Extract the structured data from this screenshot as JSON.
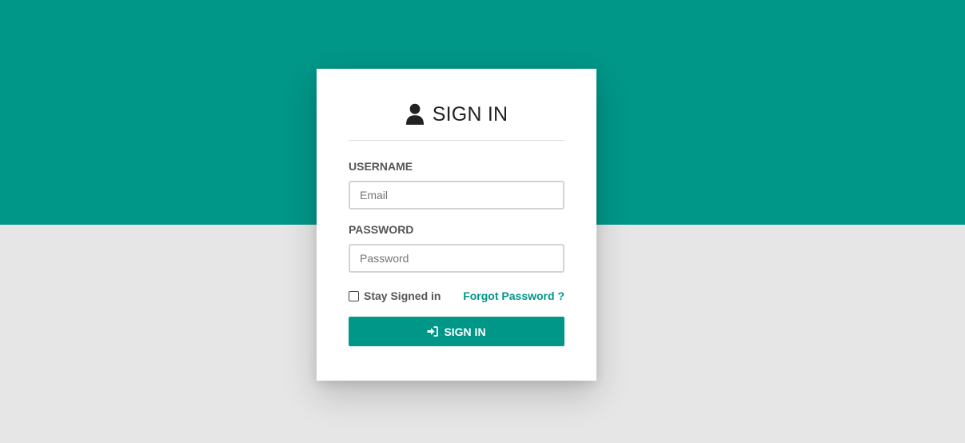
{
  "colors": {
    "accent": "#009688",
    "background": "#e6e6e6",
    "card": "#ffffff"
  },
  "card": {
    "title": "SIGN IN",
    "title_icon": "user-icon"
  },
  "username": {
    "label": "USERNAME",
    "placeholder": "Email"
  },
  "password": {
    "label": "PASSWORD",
    "placeholder": "Password"
  },
  "options": {
    "remember_label": "Stay Signed in",
    "forgot_label": "Forgot Password ?"
  },
  "submit": {
    "label": "SIGN IN",
    "icon": "sign-in-icon"
  }
}
